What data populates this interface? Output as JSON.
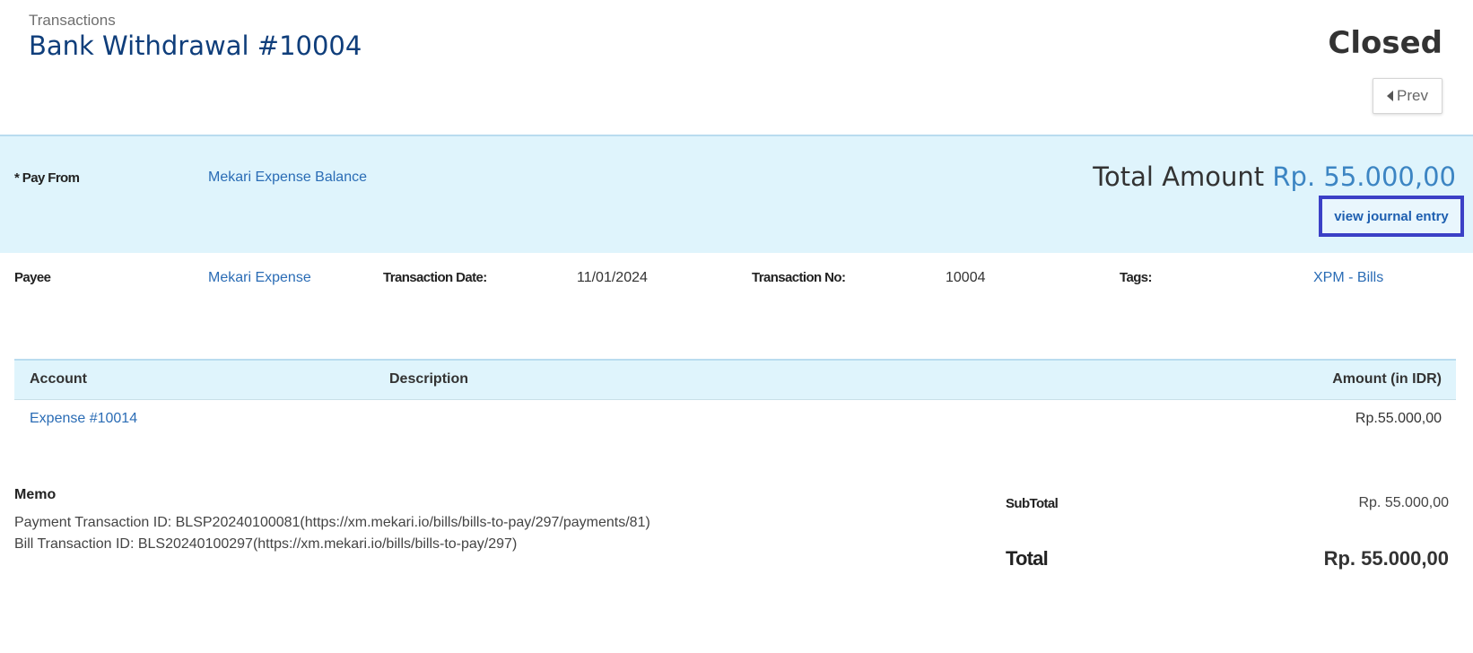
{
  "header": {
    "breadcrumb": "Transactions",
    "title": "Bank Withdrawal #10004",
    "status": "Closed",
    "prev_label": "Prev"
  },
  "summary": {
    "pay_from_label": "* Pay From",
    "pay_from_value": "Mekari Expense Balance",
    "total_label": "Total Amount",
    "total_value": "Rp. 55.000,00",
    "journal_link": "view journal entry"
  },
  "info": {
    "payee_label": "Payee",
    "payee_value": "Mekari Expense",
    "date_label": "Transaction Date:",
    "date_value": "11/01/2024",
    "number_label": "Transaction No:",
    "number_value": "10004",
    "tags_label": "Tags:",
    "tags_value": "XPM - Bills"
  },
  "table": {
    "headers": {
      "account": "Account",
      "description": "Description",
      "amount": "Amount (in IDR)"
    },
    "rows": [
      {
        "account": "Expense #10014",
        "description": "",
        "amount": "Rp.55.000,00"
      }
    ]
  },
  "memo": {
    "title": "Memo",
    "lines": [
      "Payment Transaction ID: BLSP20240100081(https://xm.mekari.io/bills/bills-to-pay/297/payments/81)",
      "Bill Transaction ID: BLS20240100297(https://xm.mekari.io/bills/bills-to-pay/297)"
    ]
  },
  "totals": {
    "subtotal_label": "SubTotal",
    "subtotal_value": "Rp. 55.000,00",
    "total_label": "Total",
    "total_value": "Rp. 55.000,00"
  },
  "colors": {
    "title": "#0f3e7b",
    "link": "#2a6cb5",
    "summary_bg": "#dff4fc",
    "highlight_border": "#3b40c6"
  },
  "icons": {
    "prev": "caret-left-icon"
  }
}
